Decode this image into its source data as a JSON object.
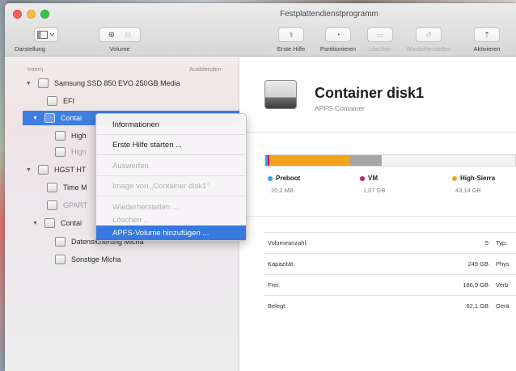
{
  "window": {
    "title": "Festplattendienstprogramm"
  },
  "toolbar": {
    "view_label": "Darstellung",
    "volume_label": "Volume",
    "first_aid_label": "Erste Hilfe",
    "partition_label": "Partitionieren",
    "erase_label": "Löschen",
    "restore_label": "Wiederherstellen",
    "mount_label": "Aktivieren"
  },
  "sidebar": {
    "section_label": "Intern",
    "hide_label": "Ausblenden",
    "items": [
      {
        "label": "Samsung SSD 850 EVO 250GB Media"
      },
      {
        "label": "EFI"
      },
      {
        "label": "Contai"
      },
      {
        "label": "High"
      },
      {
        "label": "High"
      },
      {
        "label": "HGST HT"
      },
      {
        "label": "Time M"
      },
      {
        "label": "GPART"
      },
      {
        "label": "Contai"
      },
      {
        "label": "Datensicherung Micha"
      },
      {
        "label": "Sonstige Micha"
      }
    ]
  },
  "context_menu": {
    "items": [
      {
        "label": "Informationen"
      },
      {
        "label": "Erste Hilfe starten ..."
      },
      {
        "label": "Auswerfen"
      },
      {
        "label": "Image von „Container disk1“"
      },
      {
        "label": "Wiederherstellen ..."
      },
      {
        "label": "Löschen ..."
      },
      {
        "label": "APFS-Volume hinzufügen ..."
      }
    ]
  },
  "main": {
    "title": "Container disk1",
    "subtitle": "APFS-Container",
    "usage": [
      {
        "name": "Preboot",
        "size": "20,2 MB",
        "color": "#2aa7e6",
        "fraction": 0.01
      },
      {
        "name": "VM",
        "size": "1,07 GB",
        "color": "#d5176b",
        "fraction": 0.004
      },
      {
        "name": "High-Sierra",
        "size": "43,14 GB",
        "color": "#f7a21b",
        "fraction": 0.32
      },
      {
        "name": "",
        "size": "",
        "color": "#a6a6a6",
        "fraction": 0.13
      }
    ],
    "info_rows": [
      {
        "key": "Volumeanzahl:",
        "value": "5",
        "key2": "Typ:"
      },
      {
        "key": "Kapazität:",
        "value": "249 GB",
        "key2": "Phys"
      },
      {
        "key": "Frei:",
        "value": "186,9 GB",
        "key2": "Verb"
      },
      {
        "key": "Belegt:",
        "value": "62,1 GB",
        "key2": "Gerä"
      }
    ]
  }
}
